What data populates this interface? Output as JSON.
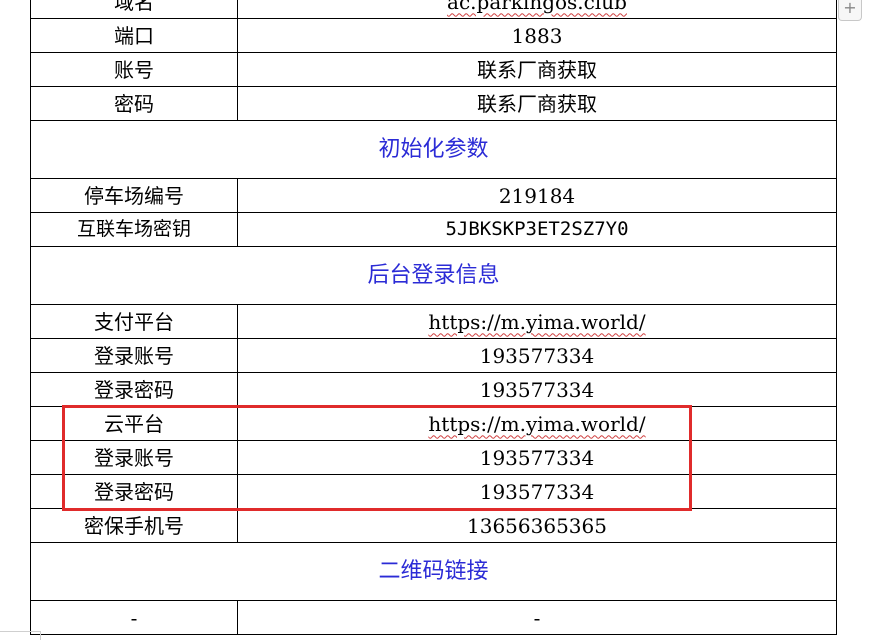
{
  "zoom_control": {
    "label": "+"
  },
  "table": {
    "rows": [
      {
        "label": "域名",
        "value": "ac.parkingos.club"
      },
      {
        "label": "端口",
        "value": "1883"
      },
      {
        "label": "账号",
        "value": "联系厂商获取"
      },
      {
        "label": "密码",
        "value": "联系厂商获取"
      },
      {
        "section": "初始化参数"
      },
      {
        "label": "停车场编号",
        "value": "219184"
      },
      {
        "label": "互联车场密钥",
        "value": "5JBKSKP3ET2SZ7Y0"
      },
      {
        "section": "后台登录信息"
      },
      {
        "label": "支付平台",
        "value": "https://m.yima.world/"
      },
      {
        "label": "登录账号",
        "value": "193577334"
      },
      {
        "label": "登录密码",
        "value": "193577334"
      },
      {
        "label": "云平台",
        "value": "https://m.yima.world/"
      },
      {
        "label": "登录账号",
        "value": "193577334"
      },
      {
        "label": "登录密码",
        "value": "193577334"
      },
      {
        "label": "密保手机号",
        "value": "13656365365"
      },
      {
        "section": "二维码链接"
      },
      {
        "label": "-",
        "value": "-"
      }
    ]
  },
  "colors": {
    "section_heading": "#2b2bd6",
    "highlight_box": "#e02b2b"
  }
}
